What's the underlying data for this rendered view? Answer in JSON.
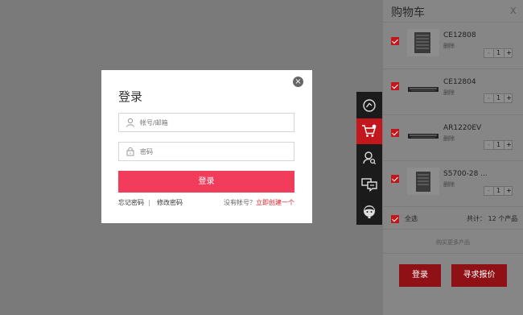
{
  "login": {
    "close_glyph": "×",
    "title": "登录",
    "account_placeholder": "帐号/邮箱",
    "password_placeholder": "密码",
    "submit_label": "登录",
    "forgot_label": "忘记密码",
    "separator": "|",
    "change_label": "修改密码",
    "no_account_text": "没有帐号？",
    "register_label": "立即创建一个"
  },
  "side_toolbar": [
    {
      "icon": "help-icon"
    },
    {
      "icon": "cart-icon",
      "active": true
    },
    {
      "icon": "user-search-icon"
    },
    {
      "icon": "chat-icon"
    },
    {
      "icon": "support-avatar-icon"
    }
  ],
  "cart": {
    "title": "购物车",
    "close_glyph": "X",
    "items": [
      {
        "name": "CE12808",
        "delete_label": "删除",
        "qty": "1",
        "minus": "-",
        "plus": "+",
        "checked": true
      },
      {
        "name": "CE12804",
        "delete_label": "删除",
        "qty": "1",
        "minus": "-",
        "plus": "+",
        "checked": true
      },
      {
        "name": "AR1220EV",
        "delete_label": "删除",
        "qty": "1",
        "minus": "-",
        "plus": "+",
        "checked": true
      },
      {
        "name": "S5700-28 ...",
        "delete_label": "删除",
        "qty": "1",
        "minus": "-",
        "plus": "+",
        "checked": true
      }
    ],
    "select_all_label": "全选",
    "total_text": "共计： 12 个产品",
    "more_label": "购买更多产品",
    "login_button": "登录",
    "quote_button": "寻求报价"
  },
  "colors": {
    "accent_red": "#f13d5b",
    "brand_red": "#c1171d",
    "overlay": "#7a7a7a"
  }
}
